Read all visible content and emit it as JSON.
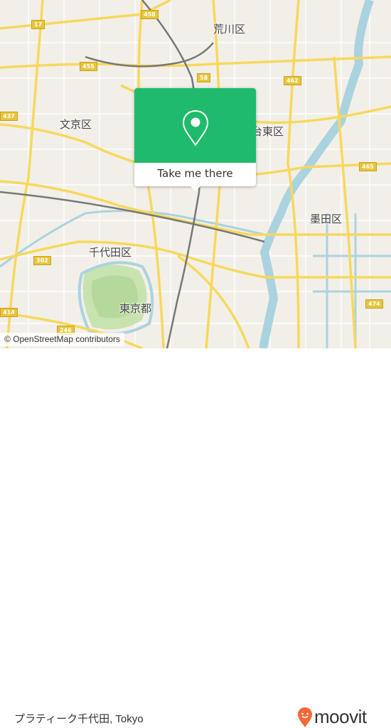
{
  "map": {
    "labels": {
      "arakawa": "荒川区",
      "bunkyo": "文京区",
      "taito": "台東区",
      "sumida": "墨田区",
      "chiyoda": "千代田区",
      "tokyo": "東京都"
    },
    "route_shields": [
      "458",
      "17",
      "455",
      "58",
      "462",
      "437",
      "465",
      "302",
      "414",
      "246",
      "474"
    ],
    "colors": {
      "land": "#f2efe9",
      "road_major": "#f7d85c",
      "water": "#aad3df",
      "park": "#c8e2b0",
      "rail": "#888888"
    }
  },
  "attribution": "© OpenStreetMap contributors",
  "popup": {
    "icon": "map-pin-icon",
    "button_label": "Take me there",
    "color": "#1fba6c"
  },
  "footer": {
    "place": "プラティーク千代田, Tokyo",
    "brand": "moovit",
    "brand_color": "#f26a3a"
  }
}
